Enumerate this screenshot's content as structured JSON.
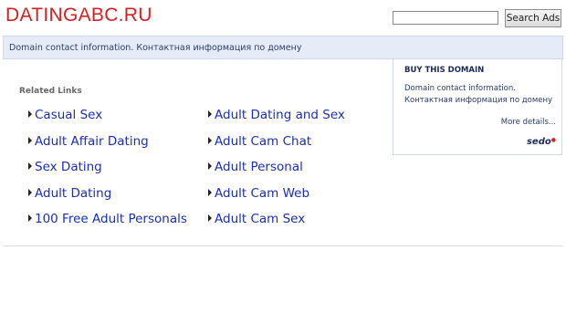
{
  "header": {
    "logo": "DATINGABC.RU",
    "search_placeholder": "",
    "search_button": "Search Ads"
  },
  "topbar": {
    "text": "Domain contact information. Контактная информация по домену"
  },
  "related": {
    "title": "Related Links",
    "left": [
      "Casual Sex",
      "Adult Affair Dating",
      "Sex Dating",
      "Adult Dating",
      "100 Free Adult Personals"
    ],
    "right": [
      "Adult Dating and Sex",
      "Adult Cam Chat",
      "Adult Personal",
      "Adult Cam Web",
      "Adult Cam Sex"
    ]
  },
  "side": {
    "title": "BUY THIS DOMAIN",
    "text": "Domain contact information. Контактная информация по домену",
    "more": "More details...",
    "logo": "sedo"
  },
  "colors": {
    "logo": "#d42121",
    "link": "#1a2fb3",
    "bar": "#e6ecf7"
  }
}
